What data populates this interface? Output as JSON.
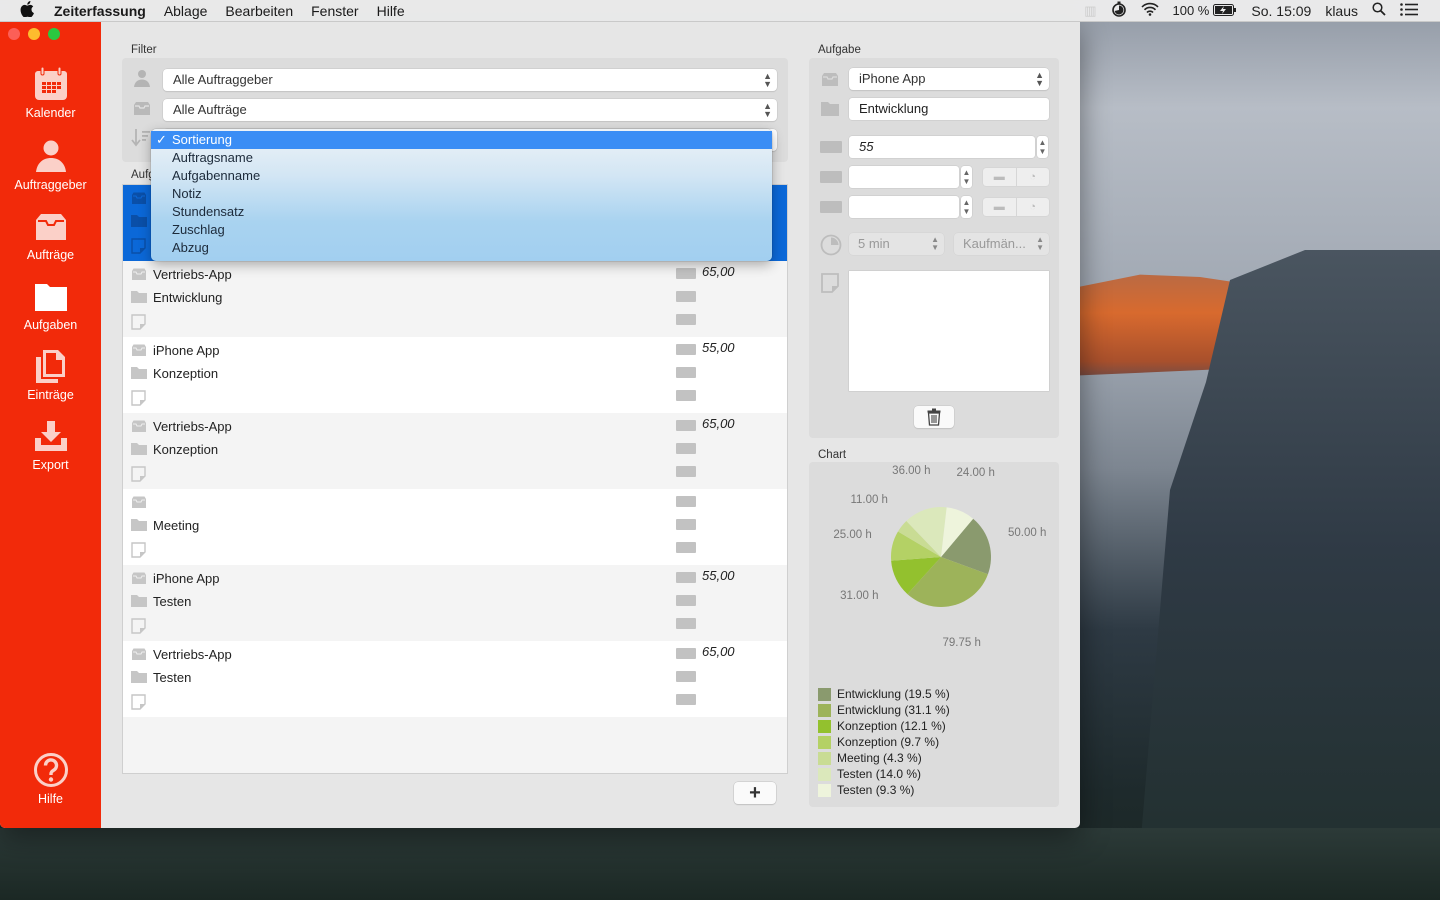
{
  "menubar": {
    "app_name": "Zeiterfassung",
    "menus": [
      "Ablage",
      "Bearbeiten",
      "Fenster",
      "Hilfe"
    ],
    "battery": "100 %",
    "clock": "So. 15:09",
    "user": "klaus"
  },
  "sidebar": {
    "items": [
      {
        "label": "Kalender",
        "icon": "calendar-icon"
      },
      {
        "label": "Auftraggeber",
        "icon": "person-icon"
      },
      {
        "label": "Aufträge",
        "icon": "inbox-tray-icon"
      },
      {
        "label": "Aufgaben",
        "icon": "folder-icon"
      },
      {
        "label": "Einträge",
        "icon": "documents-icon"
      },
      {
        "label": "Export",
        "icon": "download-icon"
      }
    ],
    "help_label": "Hilfe"
  },
  "filter": {
    "label": "Filter",
    "client_select": "Alle Auftraggeber",
    "order_select": "Alle Aufträge",
    "sort_menu": {
      "selected": "Sortierung",
      "options": [
        "Sortierung",
        "Auftragsname",
        "Aufgabenname",
        "Notiz",
        "Stundensatz",
        "Zuschlag",
        "Abzug"
      ]
    }
  },
  "list": {
    "label": "Aufgaben",
    "rows": [
      {
        "order": "",
        "task": "",
        "note": "",
        "rate": "",
        "selected": true
      },
      {
        "order": "Vertriebs-App",
        "task": "Entwicklung",
        "note": "",
        "rate": "65,00"
      },
      {
        "order": "iPhone App",
        "task": "Konzeption",
        "note": "",
        "rate": "55,00"
      },
      {
        "order": "Vertriebs-App",
        "task": "Konzeption",
        "note": "",
        "rate": "65,00"
      },
      {
        "order": "",
        "task": "Meeting",
        "note": "",
        "rate": ""
      },
      {
        "order": "iPhone App",
        "task": "Testen",
        "note": "",
        "rate": "55,00"
      },
      {
        "order": "Vertriebs-App",
        "task": "Testen",
        "note": "",
        "rate": "65,00"
      }
    ],
    "add_button": "+"
  },
  "detail": {
    "label": "Aufgabe",
    "order_select": "iPhone App",
    "task_name": "Entwicklung",
    "rate": "55",
    "surcharge": "",
    "deduction": "",
    "rounding_select": "5 min",
    "rounding_mode_select": "Kaufmän...",
    "note": ""
  },
  "chart_data": {
    "type": "pie",
    "title": "Chart",
    "slices": [
      {
        "label": "Entwicklung",
        "hours": 50.0,
        "percent": 19.5,
        "color": "#8a9a6e"
      },
      {
        "label": "Entwicklung",
        "hours": 79.75,
        "percent": 31.1,
        "color": "#9db35a"
      },
      {
        "label": "Konzeption",
        "hours": 31.0,
        "percent": 12.1,
        "color": "#93c12e"
      },
      {
        "label": "Konzeption",
        "hours": 25.0,
        "percent": 9.7,
        "color": "#b4d165"
      },
      {
        "label": "Meeting",
        "hours": 11.0,
        "percent": 4.3,
        "color": "#c9dc94"
      },
      {
        "label": "Testen",
        "hours": 36.0,
        "percent": 14.0,
        "color": "#dbe8bb"
      },
      {
        "label": "Testen",
        "hours": 24.0,
        "percent": 9.3,
        "color": "#eef4dc"
      }
    ],
    "slice_labels": [
      "50.00 h",
      "79.75 h",
      "31.00 h",
      "25.00 h",
      "11.00 h",
      "36.00 h",
      "24.00 h"
    ],
    "legend": [
      "Entwicklung (19.5 %)",
      "Entwicklung (31.1 %)",
      "Konzeption (12.1 %)",
      "Konzeption (9.7 %)",
      "Meeting (4.3 %)",
      "Testen (14.0 %)",
      "Testen (9.3 %)"
    ],
    "legend_position": "bottom-left"
  }
}
